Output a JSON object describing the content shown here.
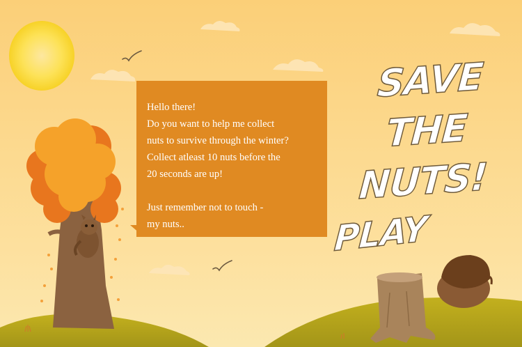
{
  "game": {
    "title": "SAVE THE NUTS!",
    "play_label": "PLAY"
  },
  "dialog": {
    "lines": [
      "Hello there!",
      "Do you want to help me collect",
      "nuts to survive through the winter?",
      "Collect atleast 10 nuts before the",
      "20 seconds are up!"
    ],
    "warning_lines": [
      "Just remember not to touch -",
      "my nuts.."
    ]
  },
  "colors": {
    "sky_top": "#fbd07a",
    "sky_bottom": "#fde3a3",
    "sun": "#fde15a",
    "hill": "#b5a51c",
    "bubble": "#e08a22",
    "tree_trunk": "#8b6240",
    "foliage": "#f29b25",
    "acorn": "#8a5a34"
  },
  "icons": [
    "sun-icon",
    "bird-icon",
    "tree-icon",
    "squirrel-icon",
    "stump-icon",
    "acorn-icon",
    "cloud-icon"
  ]
}
